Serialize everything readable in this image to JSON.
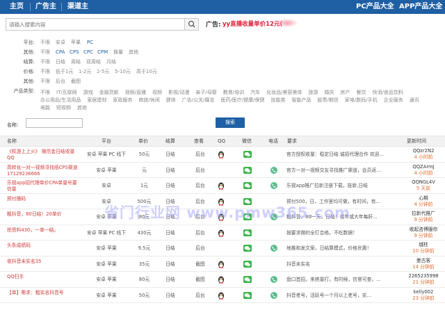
{
  "nav": {
    "items": [
      "主页",
      "广告主",
      "渠道主"
    ],
    "right_items": [
      "PC产品大全",
      "APP产品大全"
    ]
  },
  "search": {
    "placeholder": "请输入搜索内容",
    "ad_label": "广告:",
    "ad_text": "yy直播收量单价12元("
  },
  "filters": [
    {
      "label": "平台:",
      "options": [
        "不限",
        "安卓",
        "苹果",
        "PC"
      ]
    },
    {
      "label": "其他:",
      "options": [
        "不限",
        "CPA",
        "CPS",
        "CPC",
        "CPM",
        "换量",
        "其他"
      ]
    },
    {
      "label": "结算:",
      "options": [
        "不限",
        "日结",
        "周结",
        "双周结",
        "月结"
      ]
    },
    {
      "label": "价格:",
      "options": [
        "不限",
        "低于1元",
        "1-2元",
        "2-5元",
        "5-10元",
        "高于10元"
      ]
    },
    {
      "label": "其他:",
      "options": [
        "不限",
        "后台",
        "截图"
      ]
    }
  ],
  "product_types": {
    "label": "产品类型:",
    "line1": [
      "不限",
      "IT/互联网",
      "游戏",
      "金融贷款",
      "视频/直播",
      "视频",
      "影视/动漫",
      "亲子/母婴",
      "教育/培训",
      "汽车",
      "化妆品/美容美体",
      "旅游",
      "婚庆",
      "房产",
      "餐饮",
      "快消/食品饮料"
    ],
    "line2": [
      "办公用品/生活用品",
      "家居建材",
      "家政服务",
      "商旅/休闲",
      "健体",
      "广告/公关/展览",
      "医药/医疗/健康/保健",
      "技能类",
      "智能产品",
      "股票/期货",
      "家电/数码/手机",
      "企业服务",
      "通讯"
    ],
    "line3": [
      "电能",
      "短视频",
      "其他"
    ]
  },
  "name_filter": {
    "label": "名称:",
    "button": "搜索"
  },
  "table": {
    "headers": [
      "名称",
      "平台",
      "单价",
      "结算",
      "查看",
      "QQ",
      "微信",
      "电话",
      "要求",
      "更新时间"
    ],
    "rows": [
      {
        "name": "《权游上上火》 微信金日结收量QQ",
        "platform": "安卓 苹果 PC 线下",
        "price": "50元",
        "settle": "日结",
        "check": "后台",
        "qq": true,
        "wx": true,
        "tel": false,
        "req": "官方授权收量：稳定日结 诚招代理合作 欢迎...",
        "user": "QQzr2N2",
        "time": "4 小时前"
      },
      {
        "name": "高转化一对一视频寻找纸CPS渠道17129236666",
        "platform": "安卓 苹果",
        "price": "元",
        "settle": "日结",
        "check": "后台",
        "qq": false,
        "wx": true,
        "tel": true,
        "req": "官方一对一视频交友寻找推广渠道，会员返...",
        "user": "QQZArmJ",
        "time": "4 小时前"
      },
      {
        "name": "乐视app招代理单价CPA单量号要信量",
        "platform": "安卓",
        "price": "1元",
        "settle": "日结",
        "check": "后台",
        "qq": true,
        "wx": true,
        "tel": true,
        "req": "乐视app推广拉新注册下载，技新,日结",
        "user": "QQNGL4V",
        "time": "5 天前"
      },
      {
        "name": "预付撸码",
        "platform": "安卓",
        "price": "500元",
        "settle": "日结",
        "check": "后台",
        "qq": true,
        "wx": true,
        "tel": false,
        "req": "预付500，日，工作室均可做，有时间，有...",
        "user": "心期",
        "time": "4 分钟前"
      },
      {
        "name": "粗抖音，80日结！20单价",
        "platform": "安卓 苹果",
        "price": "80元",
        "settle": "日结",
        "check": "后台",
        "qq": true,
        "wx": true,
        "tel": true,
        "req": "粗抖音，80一天，日结！或年或大年每肝...",
        "user": "拉新代推广",
        "time": "9 分钟前"
      },
      {
        "name": "抢资料430，一单一结。",
        "platform": "安卓 苹果 PC 线下",
        "price": "430元",
        "settle": "日结",
        "check": "后台",
        "qq": true,
        "wx": true,
        "tel": false,
        "req": "按要求做的全打合格，不吃数据！",
        "user": "收起咨博服你",
        "time": "9 分钟前"
      },
      {
        "name": "头条成绩码",
        "platform": "安卓 苹果",
        "price": "9.5元",
        "settle": "日结",
        "check": "后台",
        "qq": false,
        "wx": true,
        "tel": true,
        "req": "地推和发文案，日结算模式，价格优惠！",
        "user": "城柱",
        "time": "10 分钟前"
      },
      {
        "name": "收抖音未实名35",
        "platform": "安卓 苹果",
        "price": "35元",
        "settle": "日结",
        "check": "截图",
        "qq": true,
        "wx": true,
        "tel": false,
        "req": "抖音未实名",
        "user": "墨古客",
        "time": "14 分钟前"
      },
      {
        "name": "QQ扫手",
        "platform": "安卓 苹果",
        "price": "80元",
        "settle": "日结",
        "check": "截图",
        "qq": true,
        "wx": true,
        "tel": true,
        "req": "盘口首招，来搭量打，有时候，信誉可查，...",
        "user": "2265235998",
        "time": "21 分钟前"
      },
      {
        "name": "【单】需求：粗实名抖音号",
        "platform": "安卓 苹果",
        "price": "50元",
        "settle": "日结",
        "check": "后台",
        "qq": true,
        "wx": true,
        "tel": true,
        "req": "抖音老号，活跃号一个月以上老号，实...",
        "user": "kelly002",
        "time": "23 分钟前"
      }
    ]
  },
  "watermark": "省门行业网 www.pmw365.com",
  "colors": {
    "nav": "#1f5fa3",
    "accent_red": "#e0203a",
    "link_red": "#d03a3a",
    "time_orange": "#e06a2a",
    "wechat_green": "#3bb54a"
  }
}
